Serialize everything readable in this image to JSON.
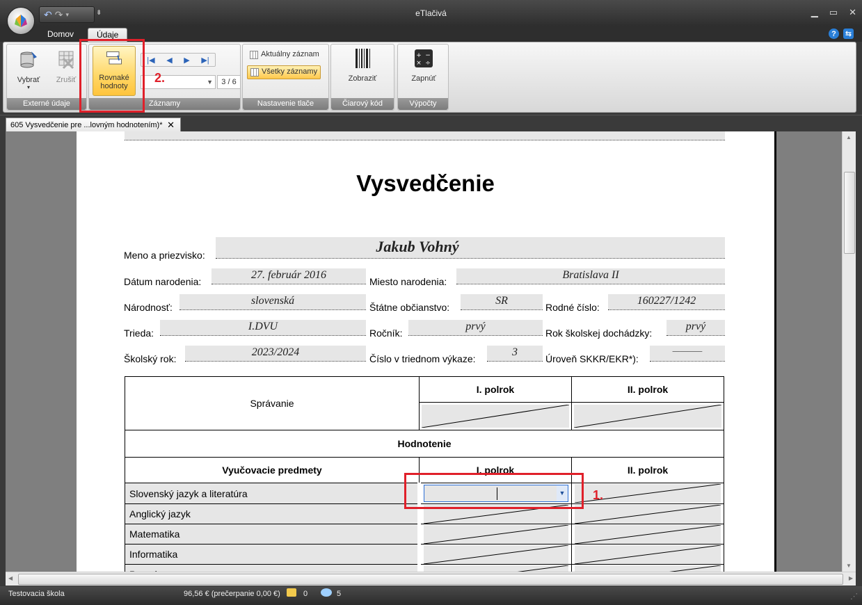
{
  "window": {
    "title": "eTlačivá"
  },
  "tabs": [
    {
      "label": "Domov"
    },
    {
      "label": "Údaje"
    }
  ],
  "ribbon": {
    "externe": {
      "vybrat": "Vybrať",
      "zrusit": "Zrušiť",
      "group": "Externé údaje"
    },
    "zaznamy": {
      "rovnake_line1": "Rovnaké",
      "rovnake_line2": "hodnoty",
      "count": "3 / 6",
      "group": "Záznamy"
    },
    "tlac": {
      "aktualny": "Aktuálny záznam",
      "vsetky": "Všetky záznamy",
      "group": "Nastavenie tlače"
    },
    "kod": {
      "zobrazit": "Zobraziť",
      "group": "Čiarový kód"
    },
    "vypocty": {
      "zapnut": "Zapnúť",
      "group": "Výpočty"
    }
  },
  "document_tab": {
    "label": "605 Vysvedčenie pre ...lovným hodnotením)*",
    "close": "✕"
  },
  "form": {
    "title": "Vysvedčenie",
    "meno_label": "Meno a priezvisko:",
    "meno_value": "Jakub Vohný",
    "datum_label": "Dátum narodenia:",
    "datum_value": "27. február 2016",
    "miesto_label": "Miesto narodenia:",
    "miesto_value": "Bratislava II",
    "narodnost_label": "Národnosť:",
    "narodnost_value": "slovenská",
    "obcianstvo_label": "Štátne občianstvo:",
    "obcianstvo_value": "SR",
    "rodne_label": "Rodné číslo:",
    "rodne_value": "160227/1242",
    "trieda_label": "Trieda:",
    "trieda_value": "I.DVU",
    "rocnik_label": "Ročník:",
    "rocnik_value": "prvý",
    "rok_doch_label": "Rok školskej dochádzky:",
    "rok_doch_value": "prvý",
    "skolsky_label": "Školský rok:",
    "skolsky_value": "2023/2024",
    "cislo_label": "Číslo v triednom výkaze:",
    "cislo_value": "3",
    "skkr_label": "Úroveň SKKR/EKR*):",
    "skkr_value": "————"
  },
  "table": {
    "spravanie": "Správanie",
    "polrok1": "I. polrok",
    "polrok2": "II. polrok",
    "hodnotenie": "Hodnotenie",
    "predmety_header": "Vyučovacie predmety",
    "subjects": [
      "Slovenský jazyk a literatúra",
      "Anglický jazyk",
      "Matematika",
      "Informatika",
      "Prvouka"
    ]
  },
  "annotations": {
    "one": "1.",
    "two": "2."
  },
  "status": {
    "school": "Testovacia škola",
    "credit": "96,56 € (prečerpanie 0,00 €)",
    "mail_count": "0",
    "msg_count": "5"
  },
  "colors": {
    "annotation_red": "#e0202a",
    "ribbon_highlight": "#ffd766",
    "field_gray": "#e6e6e6"
  }
}
